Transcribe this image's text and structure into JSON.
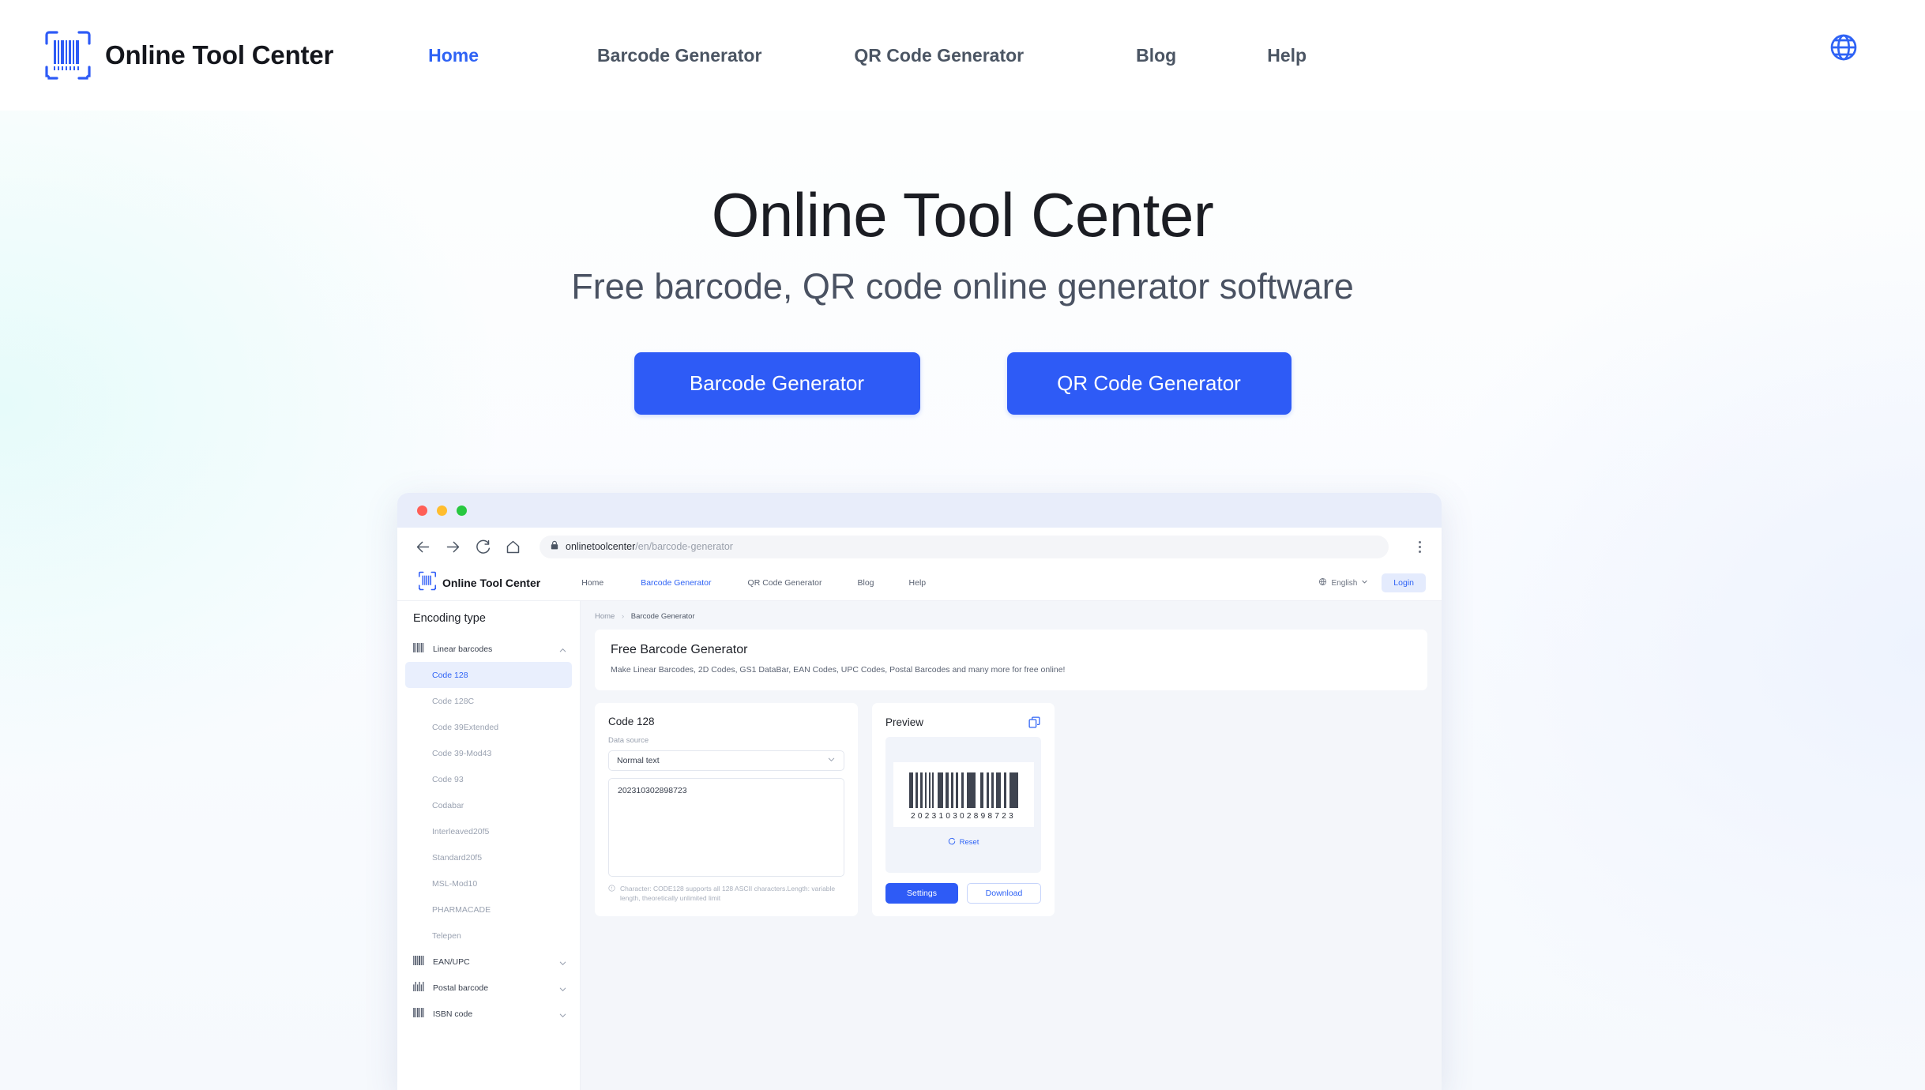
{
  "navbar": {
    "brand": "Online Tool Center",
    "brand_icon": "barcode-scan-icon",
    "links": [
      {
        "label": "Home",
        "active": true
      },
      {
        "label": "Barcode Generator",
        "active": false
      },
      {
        "label": "QR Code Generator",
        "active": false
      },
      {
        "label": "Blog",
        "active": false
      },
      {
        "label": "Help",
        "active": false
      }
    ],
    "language_icon": "globe-icon",
    "accent_color": "#2f63f5"
  },
  "hero": {
    "title": "Online Tool Center",
    "subtitle": "Free barcode, QR code online generator software",
    "cta_primary": "Barcode Generator",
    "cta_secondary": "QR Code Generator",
    "button_color": "#2e5bf6"
  },
  "mockup": {
    "titlebar": {
      "dots": [
        "red",
        "yellow",
        "green"
      ]
    },
    "toolbar": {
      "back_icon": "arrow-left-icon",
      "forward_icon": "arrow-right-icon",
      "reload_icon": "reload-icon",
      "home_icon": "home-icon",
      "lock_icon": "lock-icon",
      "url_host": "onlinetoolcenter",
      "url_path": "/en/barcode-generator",
      "menu_icon": "kebab-menu-icon"
    },
    "site_header": {
      "brand": "Online Tool Center",
      "links": [
        {
          "label": "Home",
          "active": false
        },
        {
          "label": "Barcode Generator",
          "active": true
        },
        {
          "label": "QR Code Generator",
          "active": false
        },
        {
          "label": "Blog",
          "active": false
        },
        {
          "label": "Help",
          "active": false
        }
      ],
      "language": "English",
      "login": "Login"
    },
    "sidebar": {
      "title": "Encoding type",
      "groups": [
        {
          "label": "Linear barcodes",
          "icon": "barcode-icon",
          "expanded": true,
          "items": [
            {
              "label": "Code 128",
              "selected": true
            },
            {
              "label": "Code 128C",
              "selected": false
            },
            {
              "label": "Code 39Extended",
              "selected": false
            },
            {
              "label": "Code 39-Mod43",
              "selected": false
            },
            {
              "label": "Code 93",
              "selected": false
            },
            {
              "label": "Codabar",
              "selected": false
            },
            {
              "label": "Interleaved20f5",
              "selected": false
            },
            {
              "label": "Standard20f5",
              "selected": false
            },
            {
              "label": "MSL-Mod10",
              "selected": false
            },
            {
              "label": "PHARMACADE",
              "selected": false
            },
            {
              "label": "Telepen",
              "selected": false
            }
          ]
        },
        {
          "label": "EAN/UPC",
          "icon": "ean-barcode-icon",
          "expanded": false,
          "items": []
        },
        {
          "label": "Postal barcode",
          "icon": "postal-barcode-icon",
          "expanded": false,
          "items": []
        },
        {
          "label": "ISBN code",
          "icon": "isbn-barcode-icon",
          "expanded": false,
          "items": []
        }
      ]
    },
    "breadcrumb": {
      "root": "Home",
      "separator": "›",
      "current": "Barcode Generator"
    },
    "banner": {
      "title": "Free Barcode Generator",
      "description": "Make Linear Barcodes, 2D Codes, GS1 DataBar, EAN Codes, UPC Codes, Postal Barcodes and many more for free online!"
    },
    "form": {
      "title": "Code 128",
      "data_source_label": "Data source",
      "data_source_value": "Normal text",
      "dropdown_icon": "chevron-down-icon",
      "text_value": "202310302898723",
      "hint_icon": "info-icon",
      "hint": "Character: CODE128 supports all 128 ASCII characters.Length: variable length, theoretically unlimited limit"
    },
    "preview": {
      "title": "Preview",
      "copy_icon": "copy-icon",
      "barcode_digits": "202310302898723",
      "reset_icon": "reset-icon",
      "reset_label": "Reset",
      "settings_label": "Settings",
      "download_label": "Download"
    }
  }
}
